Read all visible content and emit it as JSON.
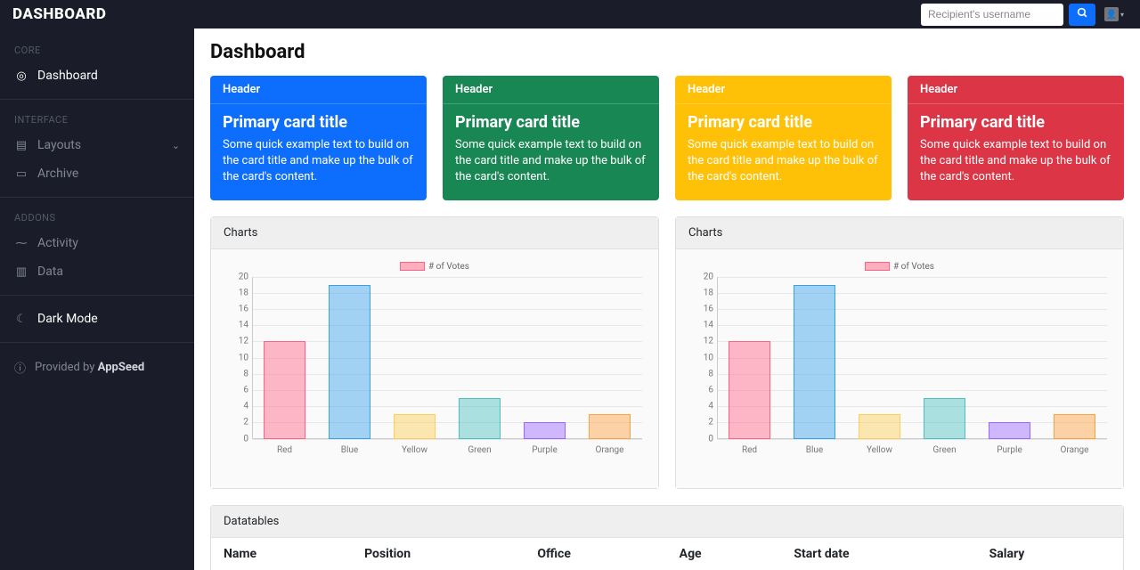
{
  "brand": "DASHBOARD",
  "search": {
    "placeholder": "Recipient's username"
  },
  "sidebar": {
    "sections": [
      {
        "header": "CORE",
        "items": [
          {
            "icon": "◎",
            "label": "Dashboard",
            "active": true
          }
        ]
      },
      {
        "header": "INTERFACE",
        "items": [
          {
            "icon": "▤",
            "label": "Layouts",
            "chev": true
          },
          {
            "icon": "▭",
            "label": "Archive"
          }
        ]
      },
      {
        "header": "ADDONS",
        "items": [
          {
            "icon": "⁓",
            "label": "Activity"
          },
          {
            "icon": "▥",
            "label": "Data"
          }
        ]
      }
    ],
    "dark_mode": {
      "icon": "☾",
      "label": "Dark Mode"
    },
    "footer": {
      "icon": "ⓘ",
      "pre": "Provided by ",
      "brand": "AppSeed"
    }
  },
  "page": {
    "title": "Dashboard"
  },
  "cards": [
    {
      "cls": "blue",
      "header": "Header",
      "title": "Primary card title",
      "text": "Some quick example text to build on the card title and make up the bulk of the card's content."
    },
    {
      "cls": "green",
      "header": "Header",
      "title": "Primary card title",
      "text": "Some quick example text to build on the card title and make up the bulk of the card's content."
    },
    {
      "cls": "yellow",
      "header": "Header",
      "title": "Primary card title",
      "text": "Some quick example text to build on the card title and make up the bulk of the card's content."
    },
    {
      "cls": "red",
      "header": "Header",
      "title": "Primary card title",
      "text": "Some quick example text to build on the card title and make up the bulk of the card's content."
    }
  ],
  "charts_title": "Charts",
  "chart_data": [
    {
      "type": "bar",
      "title": "Charts",
      "legend": "# of Votes",
      "categories": [
        "Red",
        "Blue",
        "Yellow",
        "Green",
        "Purple",
        "Orange"
      ],
      "values": [
        12,
        19,
        3,
        5,
        2,
        3
      ],
      "ylim": [
        0,
        20
      ],
      "yticks": [
        0,
        2,
        4,
        6,
        8,
        10,
        12,
        14,
        16,
        18,
        20
      ],
      "colors_bg": [
        "rgba(255,99,132,0.45)",
        "rgba(54,162,235,0.45)",
        "rgba(255,206,86,0.45)",
        "rgba(75,192,192,0.45)",
        "rgba(153,102,255,0.45)",
        "rgba(255,159,64,0.45)"
      ],
      "colors_border": [
        "rgba(255,99,132,1)",
        "rgba(54,162,235,1)",
        "rgba(255,206,86,1)",
        "rgba(75,192,192,1)",
        "rgba(153,102,255,1)",
        "rgba(255,159,64,1)"
      ]
    },
    {
      "type": "bar",
      "title": "Charts",
      "legend": "# of Votes",
      "categories": [
        "Red",
        "Blue",
        "Yellow",
        "Green",
        "Purple",
        "Orange"
      ],
      "values": [
        12,
        19,
        3,
        5,
        2,
        3
      ],
      "ylim": [
        0,
        20
      ],
      "yticks": [
        0,
        2,
        4,
        6,
        8,
        10,
        12,
        14,
        16,
        18,
        20
      ],
      "colors_bg": [
        "rgba(255,99,132,0.45)",
        "rgba(54,162,235,0.45)",
        "rgba(255,206,86,0.45)",
        "rgba(75,192,192,0.45)",
        "rgba(153,102,255,0.45)",
        "rgba(255,159,64,0.45)"
      ],
      "colors_border": [
        "rgba(255,99,132,1)",
        "rgba(54,162,235,1)",
        "rgba(255,206,86,1)",
        "rgba(75,192,192,1)",
        "rgba(153,102,255,1)",
        "rgba(255,159,64,1)"
      ]
    }
  ],
  "datatable": {
    "title": "Datatables",
    "columns": [
      "Name",
      "Position",
      "Office",
      "Age",
      "Start date",
      "Salary"
    ]
  }
}
